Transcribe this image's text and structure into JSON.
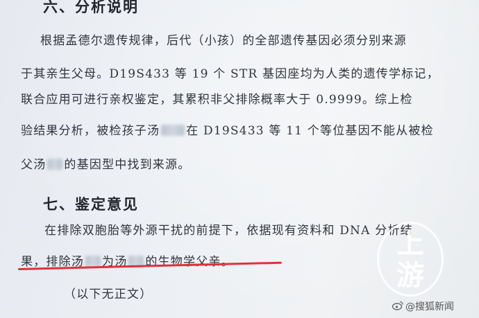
{
  "section6": {
    "heading": "六、分析说明",
    "lines": [
      "根据孟德尔遗传规律，后代（小孩）的全部遗传基因必须分别来源",
      "于其亲生父母。D19S433 等 19 个 STR 基因座均为人类的遗传学标记，",
      "联合应用可进行亲权鉴定，其累积非父排除概率大于 0.9999。综上检"
    ],
    "line4_pre": "验结果分析，被检孩子汤",
    "line4_post": "在 D19S433 等 11 个等位基因不能从被检",
    "line5_pre": "父汤",
    "line5_post": "的基因型中找到来源。"
  },
  "section7": {
    "heading": "七、鉴定意见",
    "line1": "在排除双胞胎等外源干扰的前提下，依据现有资料和 DNA 分析结",
    "line2_a": "果，排除汤",
    "line2_b": "为汤",
    "line2_c": "的生物学父亲。"
  },
  "closing": "（以下无正文）",
  "watermark": {
    "stamp_chars": [
      "上",
      "游"
    ],
    "footer": "@搜狐新闻"
  },
  "colors": {
    "underline": "#e0303a"
  }
}
